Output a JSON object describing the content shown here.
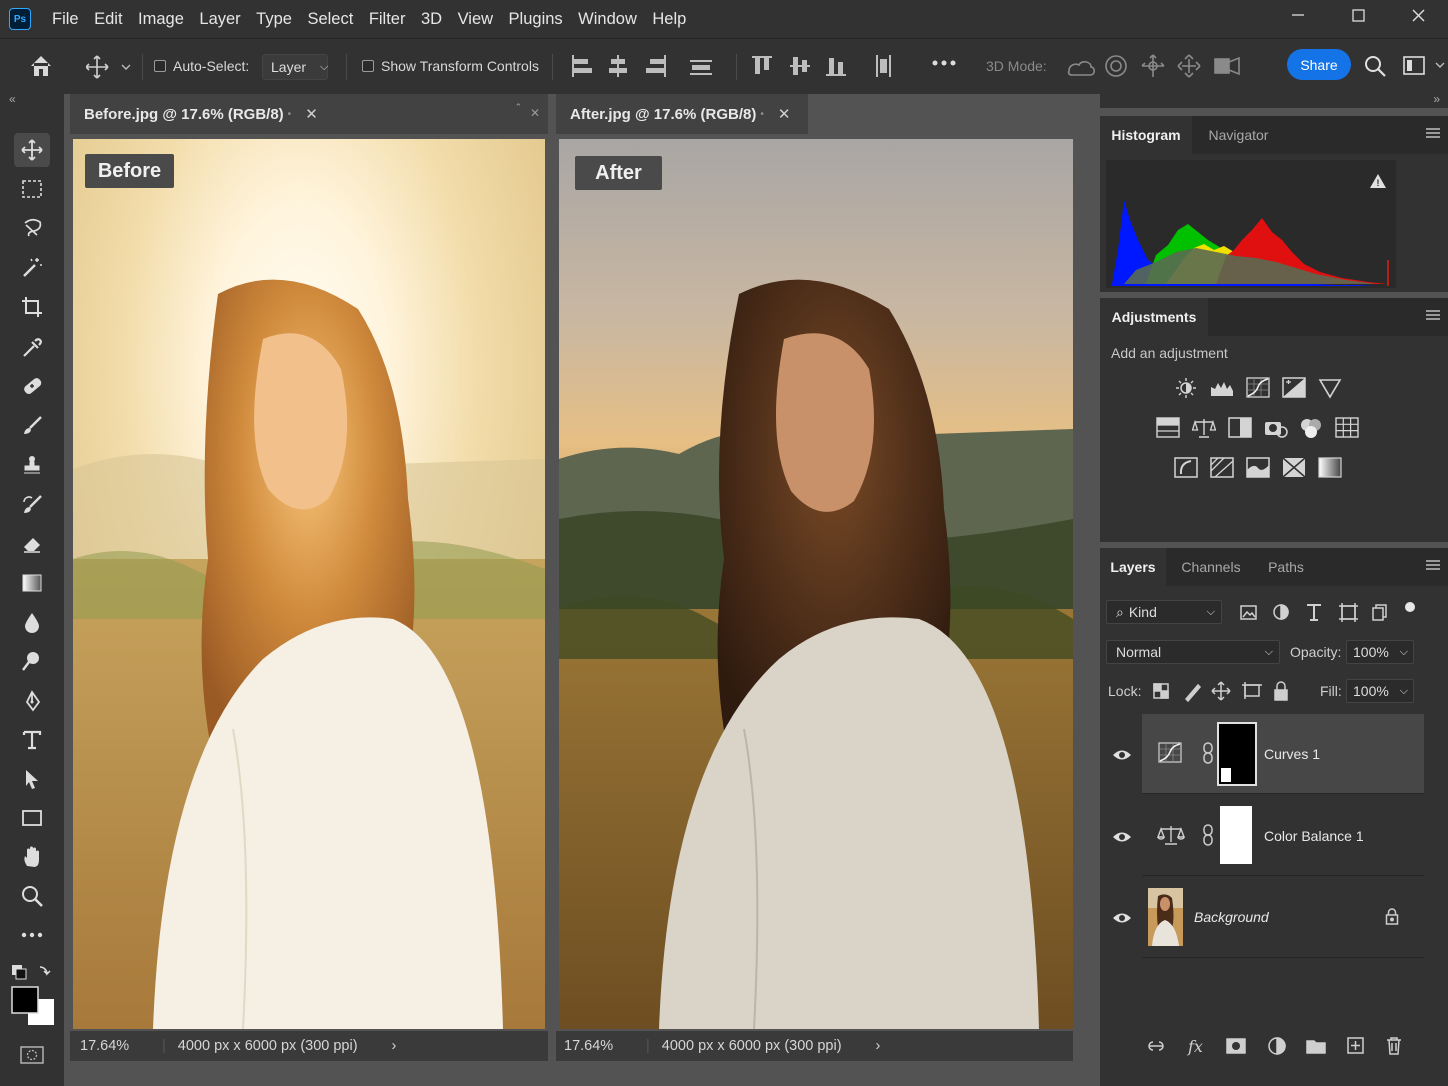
{
  "app": {
    "logo": "Ps",
    "accent": "#31a8ff"
  },
  "menu": [
    "File",
    "Edit",
    "Image",
    "Layer",
    "Type",
    "Select",
    "Filter",
    "3D",
    "View",
    "Plugins",
    "Window",
    "Help"
  ],
  "options": {
    "auto_select_label": "Auto-Select:",
    "auto_select_value": "Layer",
    "transform_label": "Show Transform Controls",
    "mode_3d_label": "3D Mode:",
    "share_label": "Share"
  },
  "documents": [
    {
      "tab_title": "Before.jpg @ 17.6% (RGB/8)",
      "badge": "Before",
      "zoom": "17.64%",
      "info": "4000 px x 6000 px (300 ppi)"
    },
    {
      "tab_title": "After.jpg @ 17.6% (RGB/8)",
      "badge": "After",
      "zoom": "17.64%",
      "info": "4000 px x 6000 px (300 ppi)"
    }
  ],
  "histogram_panel": {
    "tabs": [
      "Histogram",
      "Navigator"
    ]
  },
  "adjustments_panel": {
    "title": "Adjustments",
    "hint": "Add an adjustment",
    "icons": [
      "brightness-contrast-icon",
      "levels-icon",
      "curves-icon",
      "exposure-icon",
      "vibrance-icon",
      "hue-saturation-icon",
      "color-balance-icon",
      "black-white-icon",
      "photo-filter-icon",
      "channel-mixer-icon",
      "color-lookup-icon",
      "invert-icon",
      "posterize-icon",
      "threshold-icon",
      "selective-color-icon",
      "gradient-map-icon"
    ]
  },
  "layers_panel": {
    "tabs": [
      "Layers",
      "Channels",
      "Paths"
    ],
    "filter_kind": "Kind",
    "blend_mode": "Normal",
    "opacity_label": "Opacity:",
    "opacity_value": "100%",
    "lock_label": "Lock:",
    "fill_label": "Fill:",
    "fill_value": "100%",
    "layers": [
      {
        "name": "Curves 1",
        "type": "curves",
        "visible": true,
        "selected": true
      },
      {
        "name": "Color Balance 1",
        "type": "color-balance",
        "visible": true,
        "selected": false
      },
      {
        "name": "Background",
        "type": "pixel",
        "visible": true,
        "locked": true,
        "selected": false
      }
    ]
  }
}
